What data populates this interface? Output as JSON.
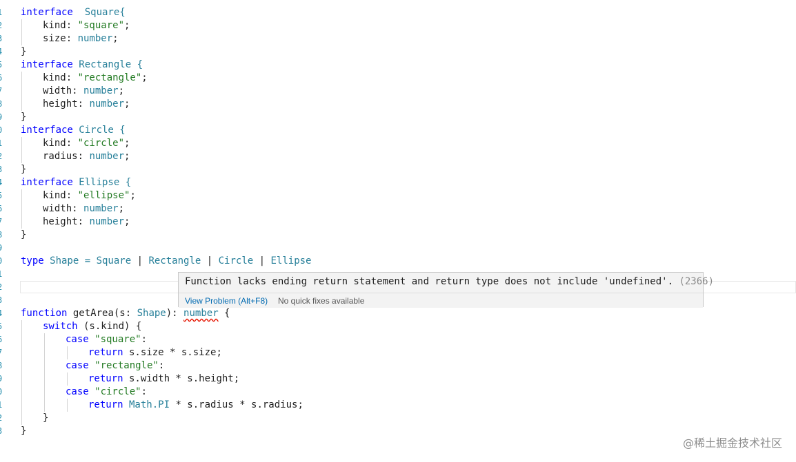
{
  "gutter": [
    "1",
    "2",
    "3",
    "4",
    "5",
    "6",
    "7",
    "8",
    "9",
    "0",
    "1",
    "2",
    "3",
    "4",
    "5",
    "6",
    "7",
    "8",
    "9",
    "0",
    "1",
    "2",
    "3",
    "4",
    "5",
    "6",
    "7",
    "8",
    "9",
    "0",
    "1",
    "2",
    "3"
  ],
  "code": {
    "l1_kw": "interface",
    "l1_name": "  Square{",
    "l2_key": "kind: ",
    "l2_val": "\"square\"",
    "l2_end": ";",
    "l3_key": "size: ",
    "l3_type": "number",
    "l3_end": ";",
    "l4": "}",
    "l5_kw": "interface",
    "l5_name": " Rectangle {",
    "l6_key": "kind: ",
    "l6_val": "\"rectangle\"",
    "l6_end": ";",
    "l7_key": "width: ",
    "l7_type": "number",
    "l7_end": ";",
    "l8_key": "height: ",
    "l8_type": "number",
    "l8_end": ";",
    "l9": "}",
    "l10_kw": "interface",
    "l10_name": " Circle {",
    "l11_key": "kind: ",
    "l11_val": "\"circle\"",
    "l11_end": ";",
    "l12_key": "radius: ",
    "l12_type": "number",
    "l12_end": ";",
    "l13": "}",
    "l14_kw": "interface",
    "l14_name": " Ellipse {",
    "l15_key": "kind: ",
    "l15_val": "\"ellipse\"",
    "l15_end": ";",
    "l16_key": "width: ",
    "l16_type": "number",
    "l16_end": ";",
    "l17_key": "height: ",
    "l17_type": "number",
    "l17_end": ";",
    "l18": "}",
    "l20_kw": "type",
    "l20_a": " Shape = ",
    "l20_t1": "Square",
    "l20_p1": " | ",
    "l20_t2": "Rectangle",
    "l20_p2": " | ",
    "l20_t3": "Circle",
    "l20_p3": " | ",
    "l20_t4": "Ellipse",
    "l23_kw": "function",
    "l23_a": " getArea(s: ",
    "l23_t": "Shape",
    "l23_b": "): ",
    "l23_ret": "number",
    "l23_c": " {",
    "l24_kw": "switch",
    "l24_a": " (s.kind) {",
    "l25_kw": "case",
    "l25_val": " \"square\"",
    "l25_end": ":",
    "l26_kw": "return",
    "l26_a": " s.size * s.size;",
    "l27_kw": "case",
    "l27_val": " \"rectangle\"",
    "l27_end": ":",
    "l28_kw": "return",
    "l28_a": " s.width * s.height;",
    "l29_kw": "case",
    "l29_val": " \"circle\"",
    "l29_end": ":",
    "l30_kw": "return",
    "l30_t": " Math.PI",
    "l30_a": " * s.radius * s.radius;",
    "l31": "}",
    "l32": "}"
  },
  "hover": {
    "message": "Function lacks ending return statement and return type does not include 'undefined'.",
    "code": " (2366)",
    "view_problem": "View Problem (Alt+F8)",
    "no_fixes": "No quick fixes available"
  },
  "watermark": "@稀土掘金技术社区"
}
